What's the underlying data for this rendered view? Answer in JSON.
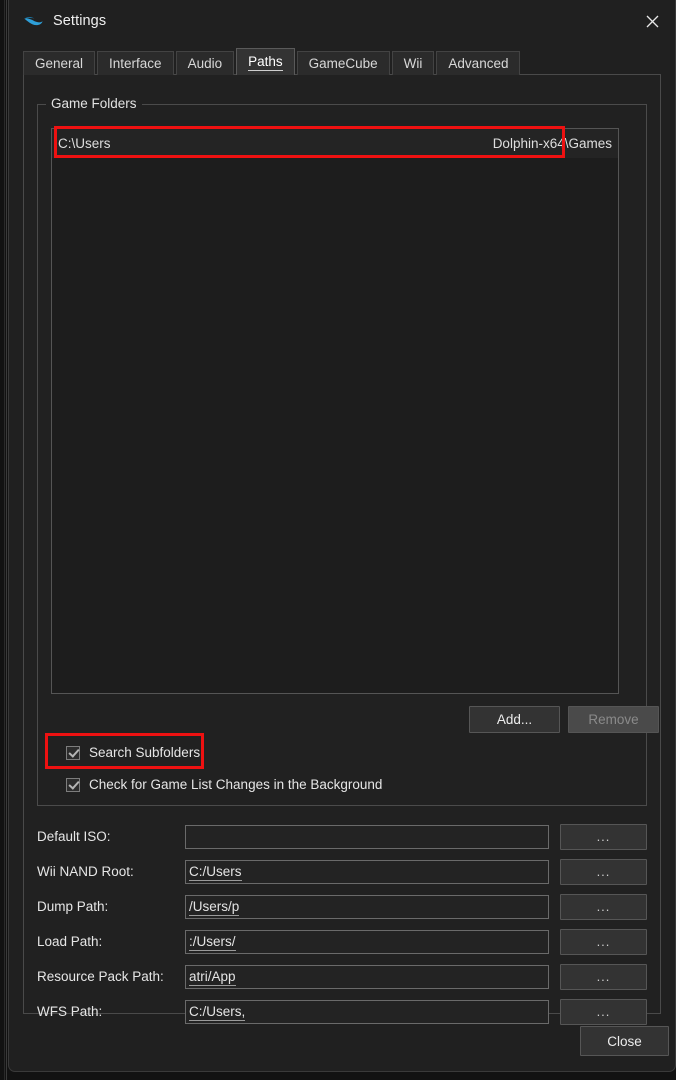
{
  "window": {
    "title": "Settings",
    "app_icon": "dolphin-logo-icon",
    "close_icon": "close-icon",
    "accent_color": "#2e9fd8",
    "annotation_color": "#ee1111"
  },
  "tabs": [
    {
      "label": "General",
      "active": false
    },
    {
      "label": "Interface",
      "active": false
    },
    {
      "label": "Audio",
      "active": false
    },
    {
      "label": "Paths",
      "active": true
    },
    {
      "label": "GameCube",
      "active": false
    },
    {
      "label": "Wii",
      "active": false
    },
    {
      "label": "Advanced",
      "active": false
    }
  ],
  "game_folders": {
    "group_label": "Game Folders",
    "rows": [
      {
        "left": "C:\\Users",
        "right": "Dolphin-x64\\Games"
      }
    ],
    "add_label": "Add...",
    "remove_label": "Remove",
    "remove_enabled": false,
    "checkboxes": [
      {
        "label": "Search Subfolders",
        "checked": true
      },
      {
        "label": "Check for Game List Changes in the Background",
        "checked": true
      }
    ]
  },
  "paths": [
    {
      "label": "Default ISO:",
      "value": "",
      "browse": "..."
    },
    {
      "label": "Wii NAND Root:",
      "value": "C:/Users",
      "browse": "..."
    },
    {
      "label": "Dump Path:",
      "value": "/Users/p",
      "browse": "..."
    },
    {
      "label": "Load Path:",
      "value": ":/Users/",
      "browse": "..."
    },
    {
      "label": "Resource Pack Path:",
      "value": "atri/App",
      "browse": "..."
    },
    {
      "label": "WFS Path:",
      "value": "C:/Users,",
      "browse": "..."
    }
  ],
  "footer": {
    "close_label": "Close"
  }
}
